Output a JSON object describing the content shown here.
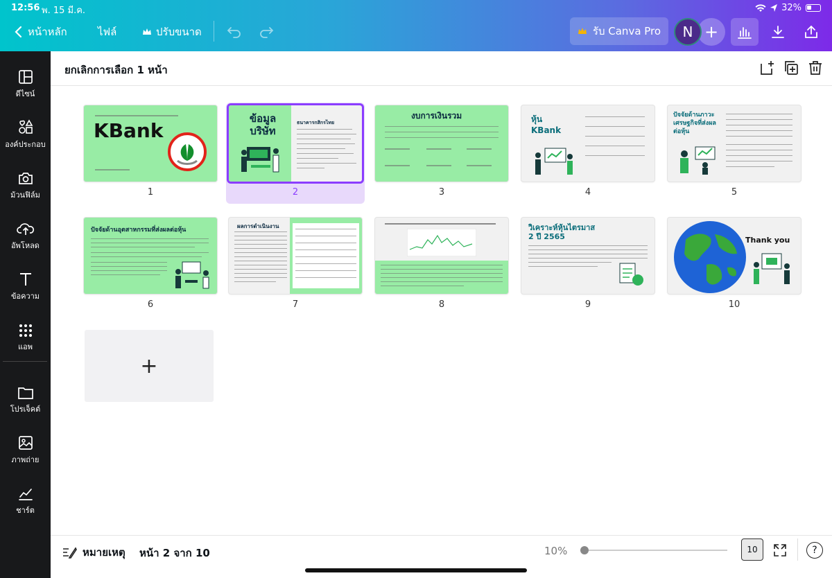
{
  "status": {
    "time": "12:56",
    "date": "พ. 15 มี.ค.",
    "battery": "32%"
  },
  "toolbar": {
    "back_label": "หน้าหลัก",
    "file_label": "ไฟล์",
    "resize_label": "ปรับขนาด",
    "pro_label": "รับ Canva Pro",
    "avatar_letter": "N"
  },
  "sidebar": {
    "items": [
      {
        "label": "ดีไซน์",
        "icon": "layout-icon"
      },
      {
        "label": "องค์ประกอบ",
        "icon": "elements-icon"
      },
      {
        "label": "ม้วนฟิล์ม",
        "icon": "camera-icon"
      },
      {
        "label": "อัพโหลด",
        "icon": "upload-icon"
      },
      {
        "label": "ข้อความ",
        "icon": "text-icon"
      },
      {
        "label": "แอพ",
        "icon": "apps-icon"
      },
      {
        "label": "โปรเจ็คต์",
        "icon": "folder-icon"
      },
      {
        "label": "ภาพถ่าย",
        "icon": "photo-icon"
      },
      {
        "label": "ชาร์ต",
        "icon": "chart-icon"
      }
    ]
  },
  "header": {
    "deselect_label": "ยกเลิกการเลือก 1 หน้า"
  },
  "slides": [
    {
      "num": "1",
      "title": "KBank"
    },
    {
      "num": "2",
      "title": "ข้อมูล บริษัท",
      "subtitle": "ธนาคารกสิกรไทย"
    },
    {
      "num": "3",
      "title": "งบการเงินรวม"
    },
    {
      "num": "4",
      "title": "หุ้น KBank"
    },
    {
      "num": "5",
      "title": "ปัจจัยด้านภาวะเศรษฐกิจที่ส่งผลต่อหุ้น"
    },
    {
      "num": "6",
      "title": "ปัจจัยด้านอุตสาหกรรมที่ส่งผลต่อหุ้น"
    },
    {
      "num": "7",
      "title": "ผลการดำเนินงาน"
    },
    {
      "num": "8"
    },
    {
      "num": "9",
      "title": "วิเคราะห์หุ้นไตรมาส 2 ปี 2565"
    },
    {
      "num": "10",
      "title": "Thank you"
    }
  ],
  "bottom": {
    "notes_label": "หมายเหตุ",
    "page_label": "หน้า 2 จาก 10",
    "zoom_label": "10%",
    "zoom_value": 10,
    "grid_count": "10",
    "help_label": "?"
  },
  "colors": {
    "accent": "#8b3dff",
    "slide_green": "#98eca5",
    "sidebar": "#18191b"
  }
}
